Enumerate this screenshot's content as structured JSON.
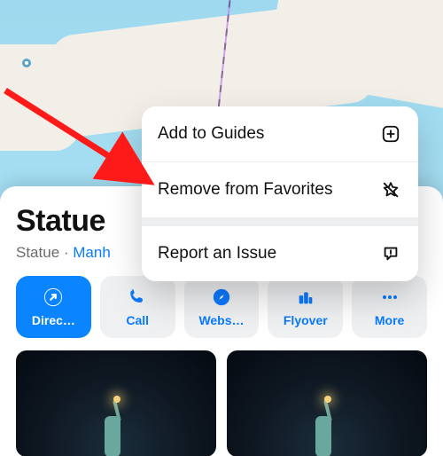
{
  "place": {
    "title": "Statue",
    "subtitle_prefix": "Statue · ",
    "subtitle_link": "Manh"
  },
  "actions": {
    "directions": "Direc…",
    "call": "Call",
    "website": "Webs…",
    "flyover": "Flyover",
    "more": "More"
  },
  "menu": {
    "add_to_guides": "Add to Guides",
    "remove_favorites": "Remove from Favorites",
    "report_issue": "Report an Issue"
  }
}
